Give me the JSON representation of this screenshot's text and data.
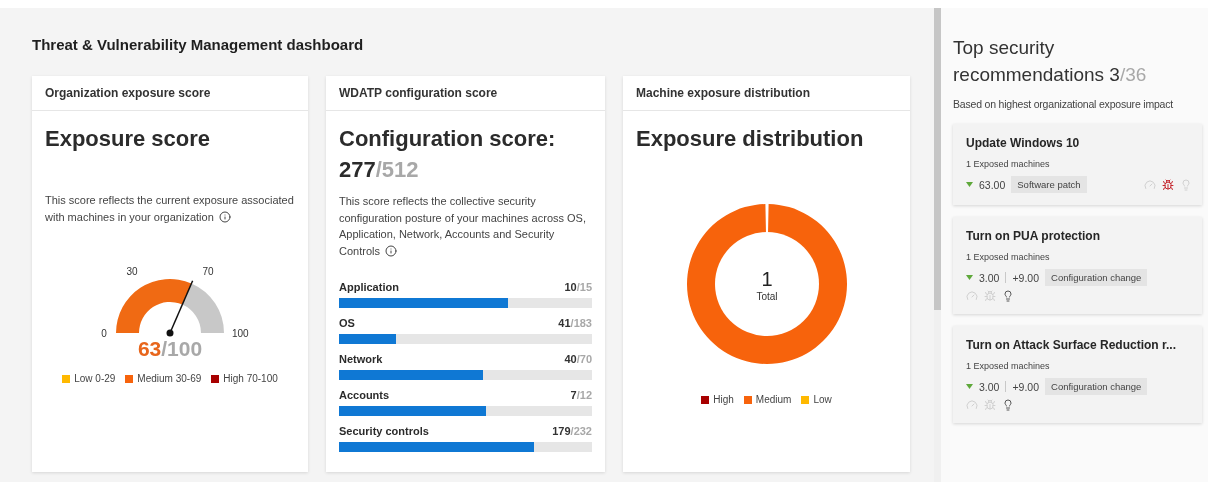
{
  "main": {
    "title": "Threat & Vulnerability Management dashboard"
  },
  "exposure_card": {
    "header": "Organization exposure score",
    "title": "Exposure score",
    "description": "This score reflects the current exposure associated with machines in your organization",
    "gauge": {
      "ticks": [
        "0",
        "30",
        "70",
        "100"
      ]
    },
    "score": "63",
    "max": "/100",
    "legend": [
      {
        "label": "Low 0-29",
        "color": "#ffb900"
      },
      {
        "label": "Medium 30-69",
        "color": "#f7630c"
      },
      {
        "label": "High 70-100",
        "color": "#a80000"
      }
    ]
  },
  "config_card": {
    "header": "WDATP configuration score",
    "title": "Configuration score:",
    "score": "277",
    "max": "/512",
    "description": "This score reflects the collective security configuration posture of your machines across OS, Application, Network, Accounts and Security Controls",
    "categories": [
      {
        "name": "Application",
        "value": "10",
        "max": "/15",
        "level": 0.667
      },
      {
        "name": "OS",
        "value": "41",
        "max": "/183",
        "level": 0.224
      },
      {
        "name": "Network",
        "value": "40",
        "max": "/70",
        "level": 0.571
      },
      {
        "name": "Accounts",
        "value": "7",
        "max": "/12",
        "level": 0.583
      },
      {
        "name": "Security controls",
        "value": "179",
        "max": "/232",
        "level": 0.772
      }
    ]
  },
  "distribution_card": {
    "header": "Machine exposure distribution",
    "title": "Exposure distribution",
    "total": "1",
    "total_label": "Total",
    "chart_data": {
      "type": "donut",
      "categories": [
        "High",
        "Medium",
        "Low"
      ],
      "values": [
        0,
        100,
        0
      ]
    },
    "legend": [
      {
        "color": "#a80000"
      },
      {
        "color": "#f7630c"
      },
      {
        "color": "#ffb900"
      }
    ]
  },
  "recommendations": {
    "heading": "Top security recommendations",
    "count": "3",
    "total": "/36",
    "subtitle": "Based on highest organizational exposure impact",
    "cards": [
      {
        "title": "Update Windows 10",
        "exposed": "1 Exposed machines",
        "score": "63.00",
        "tag": "Software patch",
        "icons": [
          {
            "kind": "threat",
            "active": false
          },
          {
            "kind": "bug",
            "active": true
          },
          {
            "kind": "insight",
            "active": false
          }
        ]
      },
      {
        "title": "Turn on PUA protection",
        "exposed": "1 Exposed machines",
        "score": "3.00",
        "config_score": "+9.00",
        "tag": "Configuration change",
        "icons": [
          {
            "kind": "threat",
            "active": false
          },
          {
            "kind": "bug",
            "active": false
          },
          {
            "kind": "insight",
            "active": true
          }
        ]
      },
      {
        "title": "Turn on Attack Surface Reduction r...",
        "exposed": "1 Exposed machines",
        "score": "3.00",
        "config_score": "+9.00",
        "tag": "Configuration change",
        "icons": [
          {
            "kind": "threat",
            "active": false
          },
          {
            "kind": "bug",
            "active": false
          },
          {
            "kind": "insight",
            "active": true
          }
        ]
      }
    ]
  }
}
